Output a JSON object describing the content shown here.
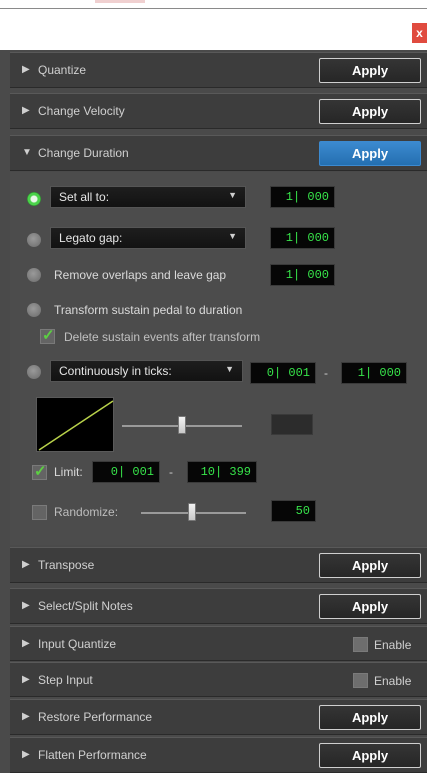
{
  "window": {
    "close_label": "x"
  },
  "sections": [
    {
      "arrow": "▶",
      "title": "Quantize",
      "button": "Apply"
    },
    {
      "arrow": "▶",
      "title": "Change Velocity",
      "button": "Apply"
    },
    {
      "arrow": "▼",
      "title": "Change Duration",
      "button": "Apply"
    },
    {
      "arrow": "▶",
      "title": "Transpose",
      "button": "Apply"
    },
    {
      "arrow": "▶",
      "title": "Select/Split Notes",
      "button": "Apply"
    },
    {
      "arrow": "▶",
      "title": "Input Quantize",
      "enable": "Enable"
    },
    {
      "arrow": "▶",
      "title": "Step Input",
      "enable": "Enable"
    },
    {
      "arrow": "▶",
      "title": "Restore Performance",
      "button": "Apply"
    },
    {
      "arrow": "▶",
      "title": "Flatten Performance",
      "button": "Apply"
    }
  ],
  "duration": {
    "set_all": {
      "selected": true,
      "mode": "Set all to:",
      "value": "1| 000"
    },
    "legato": {
      "mode": "Legato gap:",
      "value": "1| 000"
    },
    "remove_overlaps": {
      "label": "Remove overlaps and leave gap",
      "value": "1| 000"
    },
    "transform_sustain": {
      "label": "Transform sustain pedal to duration"
    },
    "delete_sustain": {
      "label": "Delete sustain events after transform",
      "checked": true
    },
    "continuous": {
      "mode": "Continuously in ticks:",
      "from": "0| 001",
      "dash": "-",
      "to": "1| 000"
    },
    "limit": {
      "label": "Limit:",
      "checked": true,
      "from": "0| 001",
      "dash": "-",
      "to": "10| 399"
    },
    "randomize": {
      "label": "Randomize:",
      "checked": false,
      "value": "50"
    },
    "caret": "▼",
    "check_mark": "✓",
    "curve_color": "#b8d14a",
    "value_color": "#37e44a"
  }
}
